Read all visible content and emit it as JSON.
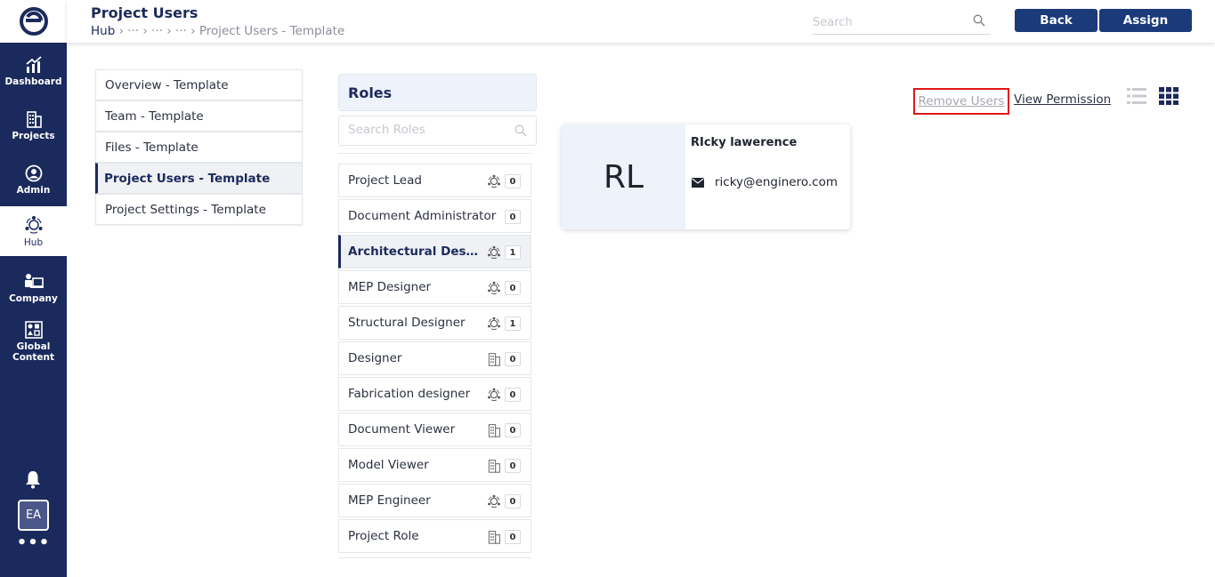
{
  "sidebar": {
    "items": [
      {
        "label": "Dashboard",
        "icon": "chart-up-icon"
      },
      {
        "label": "Projects",
        "icon": "building-icon"
      },
      {
        "label": "Admin",
        "icon": "user-circle-icon"
      },
      {
        "label": "Hub",
        "icon": "hub-icon"
      },
      {
        "label": "Company",
        "icon": "company-icon"
      },
      {
        "label": "Global Content",
        "icon": "shapes-icon"
      }
    ],
    "user_initials": "EA",
    "more": "•••"
  },
  "header": {
    "title": "Project Users",
    "breadcrumb_root": "Hub",
    "breadcrumb_rest": " › ··· › ··· › ··· › Project Users - Template",
    "search_placeholder": "Search",
    "back_label": "Back",
    "assign_label": "Assign"
  },
  "menu": {
    "items": [
      "Overview - Template",
      "Team - Template",
      "Files - Template",
      "Project Users - Template",
      "Project Settings - Template"
    ]
  },
  "roles": {
    "title": "Roles",
    "search_placeholder": "Search Roles",
    "items": [
      {
        "name": "Project Lead",
        "count": "0",
        "icon": "hub-icon"
      },
      {
        "name": "Document Administrator",
        "count": "0",
        "icon": ""
      },
      {
        "name": "Architectural Designer",
        "count": "1",
        "icon": "hub-icon"
      },
      {
        "name": "MEP Designer",
        "count": "0",
        "icon": "hub-icon"
      },
      {
        "name": "Structural Designer",
        "count": "1",
        "icon": "hub-icon"
      },
      {
        "name": "Designer",
        "count": "0",
        "icon": "building-icon"
      },
      {
        "name": "Fabrication designer",
        "count": "0",
        "icon": "hub-icon"
      },
      {
        "name": "Document Viewer",
        "count": "0",
        "icon": "building-icon"
      },
      {
        "name": "Model Viewer",
        "count": "0",
        "icon": "building-icon"
      },
      {
        "name": "MEP Engineer",
        "count": "0",
        "icon": "hub-icon"
      },
      {
        "name": "Project Role",
        "count": "0",
        "icon": "building-icon"
      }
    ]
  },
  "actions": {
    "remove_users": "Remove Users",
    "view_permission": "View Permission"
  },
  "user_card": {
    "initials": "RL",
    "name": "RIcky lawerence",
    "email": "ricky@enginero.com"
  },
  "colors": {
    "navy": "#1b2a5c",
    "button": "#1b3a7a",
    "highlight_border": "#e01818",
    "card_bg": "#eef2fb"
  }
}
